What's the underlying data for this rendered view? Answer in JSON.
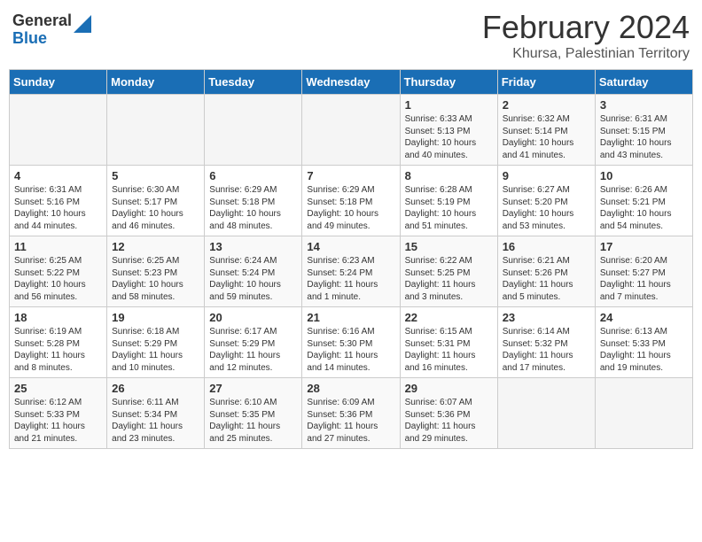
{
  "header": {
    "logo_general": "General",
    "logo_blue": "Blue",
    "month_year": "February 2024",
    "location": "Khursa, Palestinian Territory"
  },
  "days_of_week": [
    "Sunday",
    "Monday",
    "Tuesday",
    "Wednesday",
    "Thursday",
    "Friday",
    "Saturday"
  ],
  "weeks": [
    [
      {
        "day": "",
        "info": ""
      },
      {
        "day": "",
        "info": ""
      },
      {
        "day": "",
        "info": ""
      },
      {
        "day": "",
        "info": ""
      },
      {
        "day": "1",
        "info": "Sunrise: 6:33 AM\nSunset: 5:13 PM\nDaylight: 10 hours\nand 40 minutes."
      },
      {
        "day": "2",
        "info": "Sunrise: 6:32 AM\nSunset: 5:14 PM\nDaylight: 10 hours\nand 41 minutes."
      },
      {
        "day": "3",
        "info": "Sunrise: 6:31 AM\nSunset: 5:15 PM\nDaylight: 10 hours\nand 43 minutes."
      }
    ],
    [
      {
        "day": "4",
        "info": "Sunrise: 6:31 AM\nSunset: 5:16 PM\nDaylight: 10 hours\nand 44 minutes."
      },
      {
        "day": "5",
        "info": "Sunrise: 6:30 AM\nSunset: 5:17 PM\nDaylight: 10 hours\nand 46 minutes."
      },
      {
        "day": "6",
        "info": "Sunrise: 6:29 AM\nSunset: 5:18 PM\nDaylight: 10 hours\nand 48 minutes."
      },
      {
        "day": "7",
        "info": "Sunrise: 6:29 AM\nSunset: 5:18 PM\nDaylight: 10 hours\nand 49 minutes."
      },
      {
        "day": "8",
        "info": "Sunrise: 6:28 AM\nSunset: 5:19 PM\nDaylight: 10 hours\nand 51 minutes."
      },
      {
        "day": "9",
        "info": "Sunrise: 6:27 AM\nSunset: 5:20 PM\nDaylight: 10 hours\nand 53 minutes."
      },
      {
        "day": "10",
        "info": "Sunrise: 6:26 AM\nSunset: 5:21 PM\nDaylight: 10 hours\nand 54 minutes."
      }
    ],
    [
      {
        "day": "11",
        "info": "Sunrise: 6:25 AM\nSunset: 5:22 PM\nDaylight: 10 hours\nand 56 minutes."
      },
      {
        "day": "12",
        "info": "Sunrise: 6:25 AM\nSunset: 5:23 PM\nDaylight: 10 hours\nand 58 minutes."
      },
      {
        "day": "13",
        "info": "Sunrise: 6:24 AM\nSunset: 5:24 PM\nDaylight: 10 hours\nand 59 minutes."
      },
      {
        "day": "14",
        "info": "Sunrise: 6:23 AM\nSunset: 5:24 PM\nDaylight: 11 hours\nand 1 minute."
      },
      {
        "day": "15",
        "info": "Sunrise: 6:22 AM\nSunset: 5:25 PM\nDaylight: 11 hours\nand 3 minutes."
      },
      {
        "day": "16",
        "info": "Sunrise: 6:21 AM\nSunset: 5:26 PM\nDaylight: 11 hours\nand 5 minutes."
      },
      {
        "day": "17",
        "info": "Sunrise: 6:20 AM\nSunset: 5:27 PM\nDaylight: 11 hours\nand 7 minutes."
      }
    ],
    [
      {
        "day": "18",
        "info": "Sunrise: 6:19 AM\nSunset: 5:28 PM\nDaylight: 11 hours\nand 8 minutes."
      },
      {
        "day": "19",
        "info": "Sunrise: 6:18 AM\nSunset: 5:29 PM\nDaylight: 11 hours\nand 10 minutes."
      },
      {
        "day": "20",
        "info": "Sunrise: 6:17 AM\nSunset: 5:29 PM\nDaylight: 11 hours\nand 12 minutes."
      },
      {
        "day": "21",
        "info": "Sunrise: 6:16 AM\nSunset: 5:30 PM\nDaylight: 11 hours\nand 14 minutes."
      },
      {
        "day": "22",
        "info": "Sunrise: 6:15 AM\nSunset: 5:31 PM\nDaylight: 11 hours\nand 16 minutes."
      },
      {
        "day": "23",
        "info": "Sunrise: 6:14 AM\nSunset: 5:32 PM\nDaylight: 11 hours\nand 17 minutes."
      },
      {
        "day": "24",
        "info": "Sunrise: 6:13 AM\nSunset: 5:33 PM\nDaylight: 11 hours\nand 19 minutes."
      }
    ],
    [
      {
        "day": "25",
        "info": "Sunrise: 6:12 AM\nSunset: 5:33 PM\nDaylight: 11 hours\nand 21 minutes."
      },
      {
        "day": "26",
        "info": "Sunrise: 6:11 AM\nSunset: 5:34 PM\nDaylight: 11 hours\nand 23 minutes."
      },
      {
        "day": "27",
        "info": "Sunrise: 6:10 AM\nSunset: 5:35 PM\nDaylight: 11 hours\nand 25 minutes."
      },
      {
        "day": "28",
        "info": "Sunrise: 6:09 AM\nSunset: 5:36 PM\nDaylight: 11 hours\nand 27 minutes."
      },
      {
        "day": "29",
        "info": "Sunrise: 6:07 AM\nSunset: 5:36 PM\nDaylight: 11 hours\nand 29 minutes."
      },
      {
        "day": "",
        "info": ""
      },
      {
        "day": "",
        "info": ""
      }
    ]
  ]
}
